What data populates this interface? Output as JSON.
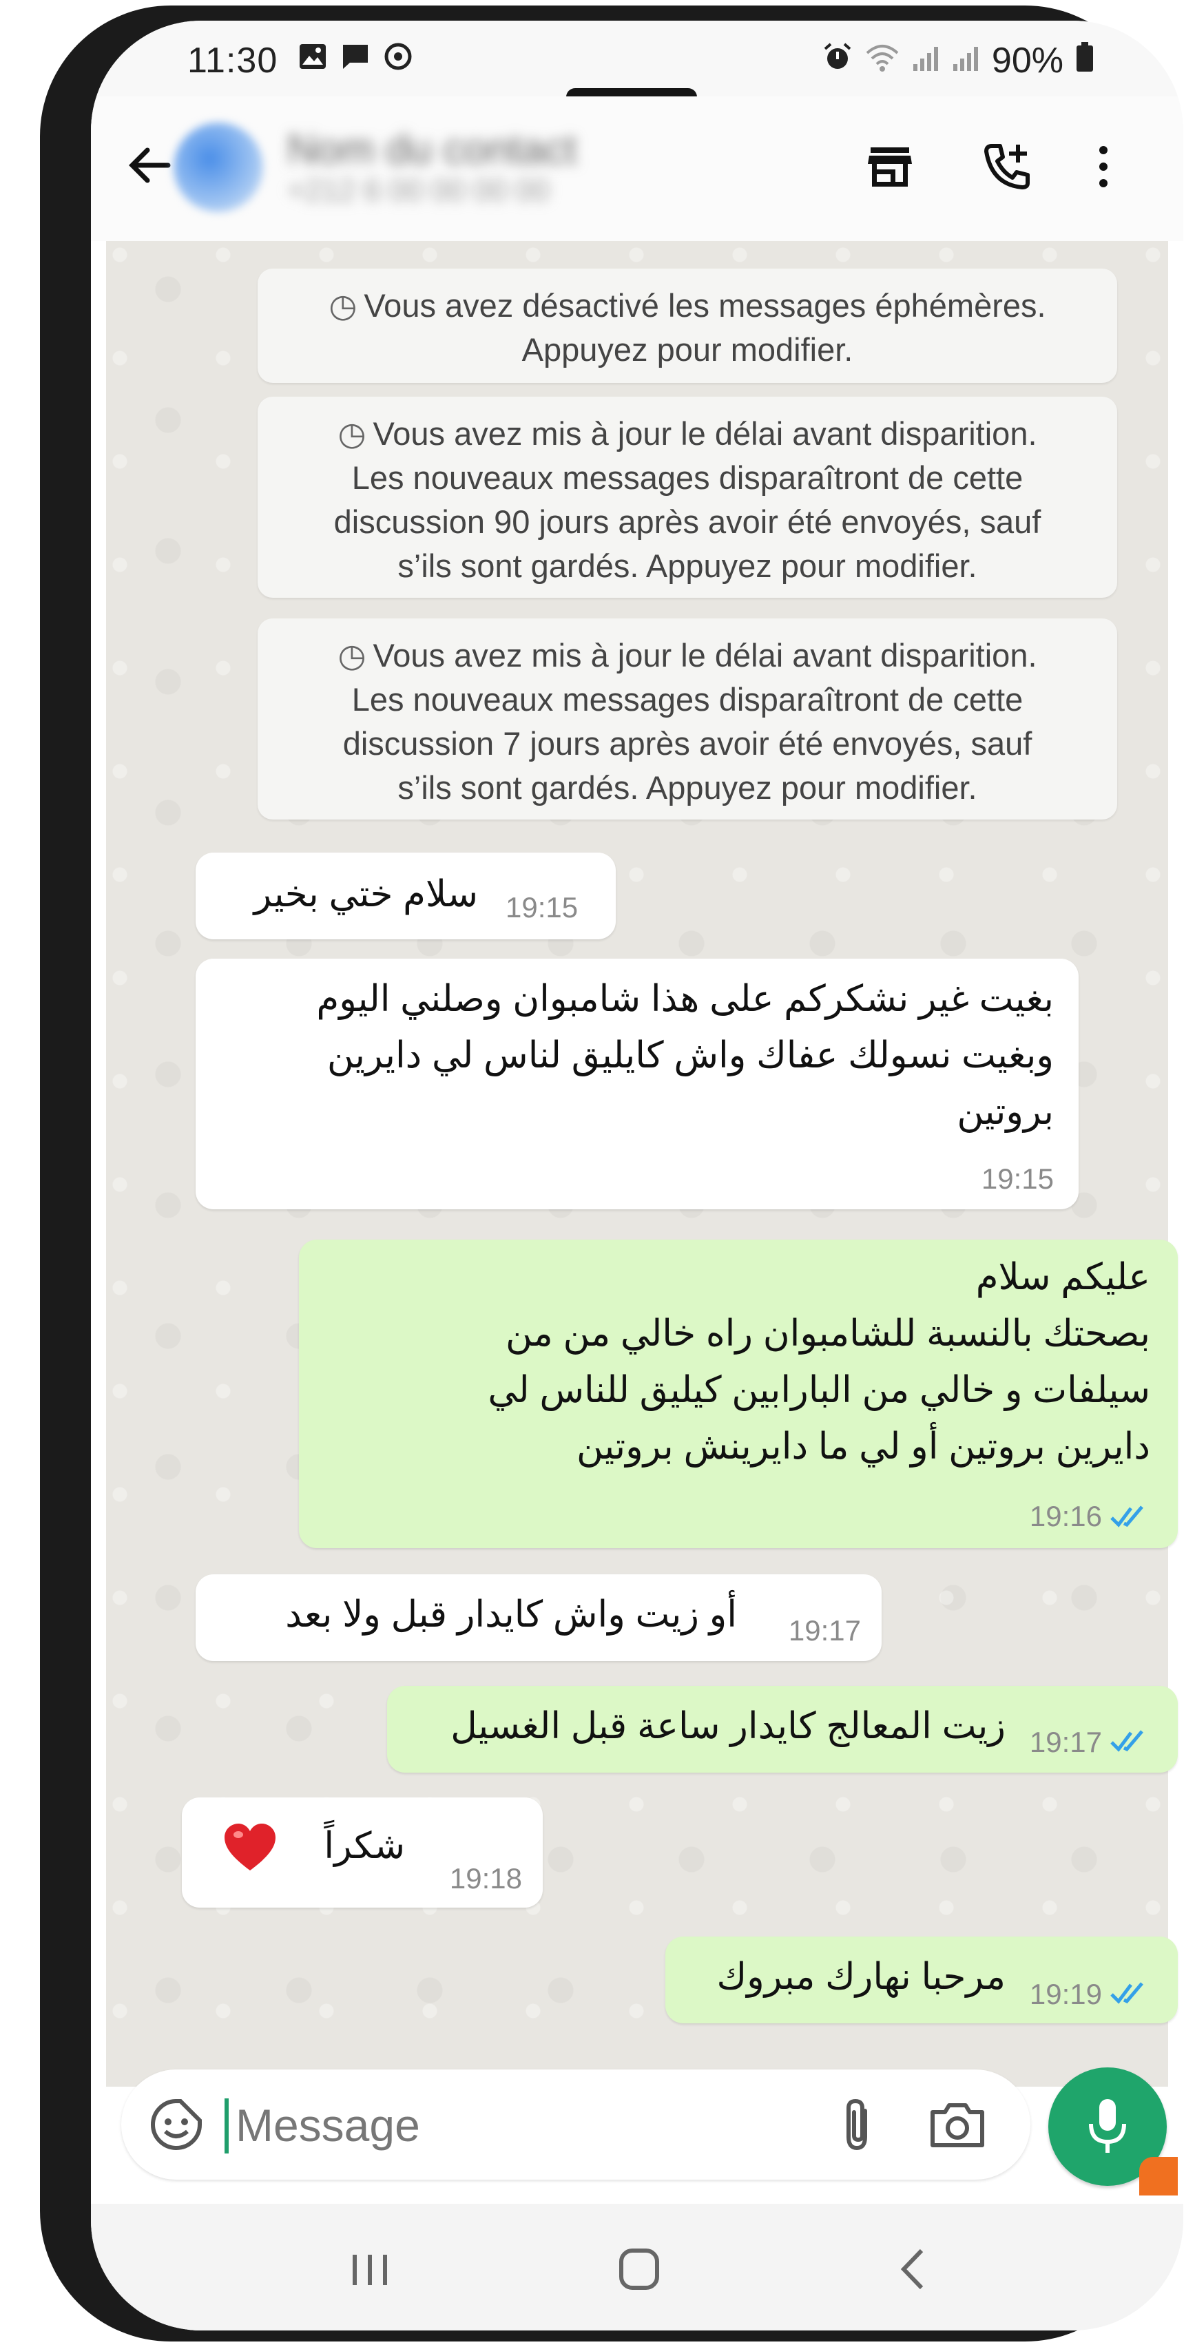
{
  "status_bar": {
    "time": "11:30",
    "battery": "90%",
    "left_icons": [
      "image-icon",
      "chat-icon",
      "sync-icon"
    ],
    "right_icons": [
      "alarm-icon",
      "wifi-icon",
      "signal-icon",
      "signal-icon",
      "battery-icon"
    ]
  },
  "header": {
    "contact_name": "Nom du contact",
    "contact_status": "+212 6 00 00 00 00",
    "icons": [
      "back-arrow-icon",
      "store-icon",
      "add-call-icon",
      "more-vertical-icon"
    ]
  },
  "system_messages": [
    {
      "lines": "Vous avez désactivé les messages éphémères.\nAppuyez pour modifier."
    },
    {
      "lines": "Vous avez mis à jour le délai avant disparition.\nLes nouveaux messages disparaîtront de cette\ndiscussion 90 jours après avoir été envoyés, sauf\ns’ils sont gardés. Appuyez pour modifier."
    },
    {
      "lines": "Vous avez mis à jour le délai avant disparition.\nLes nouveaux messages disparaîtront de cette\ndiscussion 7 jours après avoir été envoyés, sauf\ns’ils sont gardés. Appuyez pour modifier."
    }
  ],
  "messages": [
    {
      "direction": "in",
      "text": "سلام ختي بخير",
      "time": "19:15"
    },
    {
      "direction": "in",
      "text": "بغيت غير نشكركم على هذا شامبوان وصلني اليوم\nوبغيت نسولك عفاك واش كايليق لناس لي دايرين\nبروتين",
      "time": "19:15"
    },
    {
      "direction": "out",
      "text": "عليكم سلام\nبصحتك بالنسبة للشامبوان راه خالي من من\nسيلفات و خالي من البارابين كيليق للناس لي\nدايرين بروتين أو لي ما دايرينش بروتين",
      "time": "19:16",
      "status": "read"
    },
    {
      "direction": "in",
      "text": "أو زيت واش كايدار قبل ولا بعد",
      "time": "19:17"
    },
    {
      "direction": "out",
      "text": "زيت المعالج كايدار ساعة قبل الغسيل",
      "time": "19:17",
      "status": "read"
    },
    {
      "direction": "in",
      "text": "شكراً",
      "time": "19:18",
      "emoji": "red-heart-icon"
    },
    {
      "direction": "out",
      "text": "مرحبا نهارك مبروك",
      "time": "19:19",
      "status": "read"
    }
  ],
  "composer": {
    "placeholder": "Message",
    "icons": [
      "sticker-icon",
      "attach-icon",
      "camera-icon",
      "mic-icon"
    ]
  },
  "colors": {
    "incoming_bubble": "#ffffff",
    "outgoing_bubble": "#dcf8c6",
    "accent": "#1fa56b",
    "read_ticks": "#34a0e8",
    "chat_background": "#e8e6e1"
  },
  "nav_bar": {
    "icons": [
      "recent-apps-icon",
      "home-icon",
      "back-nav-icon"
    ]
  }
}
